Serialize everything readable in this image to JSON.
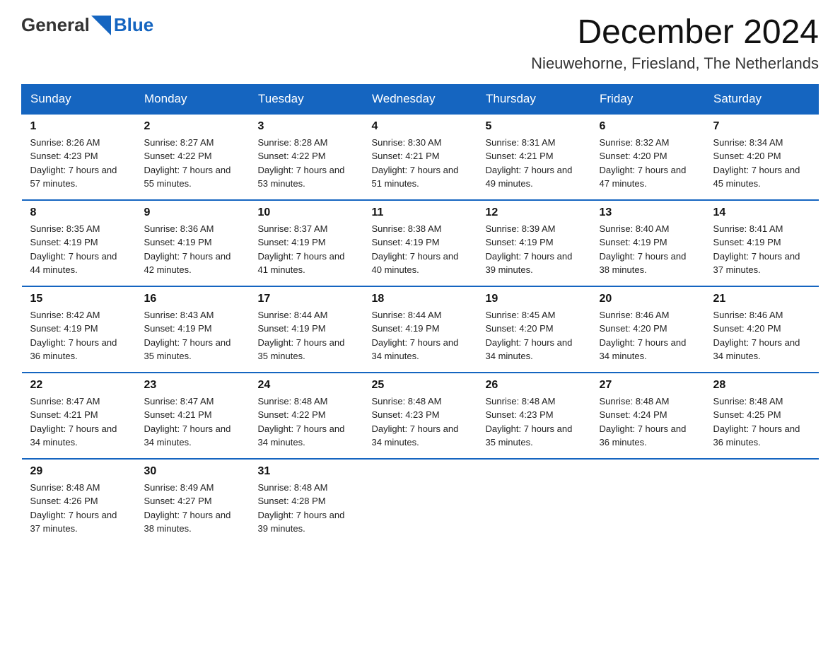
{
  "logo": {
    "text_general": "General",
    "text_blue": "Blue"
  },
  "title": "December 2024",
  "location": "Nieuwehorne, Friesland, The Netherlands",
  "weekdays": [
    "Sunday",
    "Monday",
    "Tuesday",
    "Wednesday",
    "Thursday",
    "Friday",
    "Saturday"
  ],
  "weeks": [
    [
      {
        "day": "1",
        "sunrise": "8:26 AM",
        "sunset": "4:23 PM",
        "daylight": "7 hours and 57 minutes."
      },
      {
        "day": "2",
        "sunrise": "8:27 AM",
        "sunset": "4:22 PM",
        "daylight": "7 hours and 55 minutes."
      },
      {
        "day": "3",
        "sunrise": "8:28 AM",
        "sunset": "4:22 PM",
        "daylight": "7 hours and 53 minutes."
      },
      {
        "day": "4",
        "sunrise": "8:30 AM",
        "sunset": "4:21 PM",
        "daylight": "7 hours and 51 minutes."
      },
      {
        "day": "5",
        "sunrise": "8:31 AM",
        "sunset": "4:21 PM",
        "daylight": "7 hours and 49 minutes."
      },
      {
        "day": "6",
        "sunrise": "8:32 AM",
        "sunset": "4:20 PM",
        "daylight": "7 hours and 47 minutes."
      },
      {
        "day": "7",
        "sunrise": "8:34 AM",
        "sunset": "4:20 PM",
        "daylight": "7 hours and 45 minutes."
      }
    ],
    [
      {
        "day": "8",
        "sunrise": "8:35 AM",
        "sunset": "4:19 PM",
        "daylight": "7 hours and 44 minutes."
      },
      {
        "day": "9",
        "sunrise": "8:36 AM",
        "sunset": "4:19 PM",
        "daylight": "7 hours and 42 minutes."
      },
      {
        "day": "10",
        "sunrise": "8:37 AM",
        "sunset": "4:19 PM",
        "daylight": "7 hours and 41 minutes."
      },
      {
        "day": "11",
        "sunrise": "8:38 AM",
        "sunset": "4:19 PM",
        "daylight": "7 hours and 40 minutes."
      },
      {
        "day": "12",
        "sunrise": "8:39 AM",
        "sunset": "4:19 PM",
        "daylight": "7 hours and 39 minutes."
      },
      {
        "day": "13",
        "sunrise": "8:40 AM",
        "sunset": "4:19 PM",
        "daylight": "7 hours and 38 minutes."
      },
      {
        "day": "14",
        "sunrise": "8:41 AM",
        "sunset": "4:19 PM",
        "daylight": "7 hours and 37 minutes."
      }
    ],
    [
      {
        "day": "15",
        "sunrise": "8:42 AM",
        "sunset": "4:19 PM",
        "daylight": "7 hours and 36 minutes."
      },
      {
        "day": "16",
        "sunrise": "8:43 AM",
        "sunset": "4:19 PM",
        "daylight": "7 hours and 35 minutes."
      },
      {
        "day": "17",
        "sunrise": "8:44 AM",
        "sunset": "4:19 PM",
        "daylight": "7 hours and 35 minutes."
      },
      {
        "day": "18",
        "sunrise": "8:44 AM",
        "sunset": "4:19 PM",
        "daylight": "7 hours and 34 minutes."
      },
      {
        "day": "19",
        "sunrise": "8:45 AM",
        "sunset": "4:20 PM",
        "daylight": "7 hours and 34 minutes."
      },
      {
        "day": "20",
        "sunrise": "8:46 AM",
        "sunset": "4:20 PM",
        "daylight": "7 hours and 34 minutes."
      },
      {
        "day": "21",
        "sunrise": "8:46 AM",
        "sunset": "4:20 PM",
        "daylight": "7 hours and 34 minutes."
      }
    ],
    [
      {
        "day": "22",
        "sunrise": "8:47 AM",
        "sunset": "4:21 PM",
        "daylight": "7 hours and 34 minutes."
      },
      {
        "day": "23",
        "sunrise": "8:47 AM",
        "sunset": "4:21 PM",
        "daylight": "7 hours and 34 minutes."
      },
      {
        "day": "24",
        "sunrise": "8:48 AM",
        "sunset": "4:22 PM",
        "daylight": "7 hours and 34 minutes."
      },
      {
        "day": "25",
        "sunrise": "8:48 AM",
        "sunset": "4:23 PM",
        "daylight": "7 hours and 34 minutes."
      },
      {
        "day": "26",
        "sunrise": "8:48 AM",
        "sunset": "4:23 PM",
        "daylight": "7 hours and 35 minutes."
      },
      {
        "day": "27",
        "sunrise": "8:48 AM",
        "sunset": "4:24 PM",
        "daylight": "7 hours and 36 minutes."
      },
      {
        "day": "28",
        "sunrise": "8:48 AM",
        "sunset": "4:25 PM",
        "daylight": "7 hours and 36 minutes."
      }
    ],
    [
      {
        "day": "29",
        "sunrise": "8:48 AM",
        "sunset": "4:26 PM",
        "daylight": "7 hours and 37 minutes."
      },
      {
        "day": "30",
        "sunrise": "8:49 AM",
        "sunset": "4:27 PM",
        "daylight": "7 hours and 38 minutes."
      },
      {
        "day": "31",
        "sunrise": "8:48 AM",
        "sunset": "4:28 PM",
        "daylight": "7 hours and 39 minutes."
      },
      null,
      null,
      null,
      null
    ]
  ]
}
